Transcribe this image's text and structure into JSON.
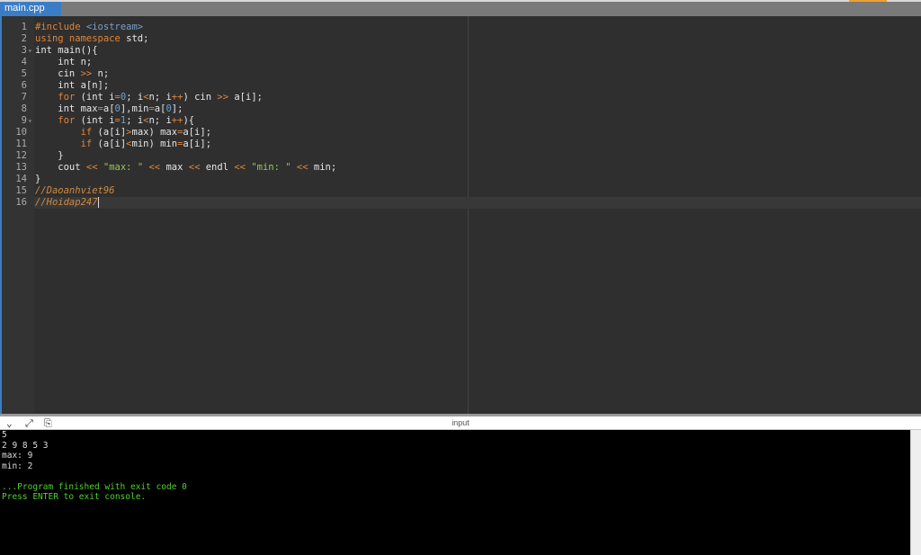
{
  "tab": {
    "label": "main.cpp"
  },
  "code": [
    [
      [
        "#include ",
        "kw"
      ],
      [
        "<iostream>",
        "inc"
      ]
    ],
    [
      [
        "using namespace",
        "kw"
      ],
      [
        " std;",
        ""
      ]
    ],
    [
      [
        "int main(){",
        ""
      ]
    ],
    [
      [
        "    int n;",
        ""
      ]
    ],
    [
      [
        "    cin ",
        ""
      ],
      [
        ">>",
        "op"
      ],
      [
        " n;",
        ""
      ]
    ],
    [
      [
        "    int a[n];",
        ""
      ]
    ],
    [
      [
        "    ",
        ""
      ],
      [
        "for",
        "kw"
      ],
      [
        " (int i",
        ""
      ],
      [
        "=",
        "op"
      ],
      [
        "0",
        "num"
      ],
      [
        "; i",
        ""
      ],
      [
        "<",
        "op"
      ],
      [
        "n; i",
        ""
      ],
      [
        "++",
        "op"
      ],
      [
        ") cin ",
        ""
      ],
      [
        ">>",
        "op"
      ],
      [
        " a[i];",
        ""
      ]
    ],
    [
      [
        "    int max",
        ""
      ],
      [
        "=",
        "op"
      ],
      [
        "a[",
        ""
      ],
      [
        "0",
        "num"
      ],
      [
        "],min",
        ""
      ],
      [
        "=",
        "op"
      ],
      [
        "a[",
        ""
      ],
      [
        "0",
        "num"
      ],
      [
        "];",
        ""
      ]
    ],
    [
      [
        "    ",
        ""
      ],
      [
        "for",
        "kw"
      ],
      [
        " (int i",
        ""
      ],
      [
        "=",
        "op"
      ],
      [
        "1",
        "num"
      ],
      [
        "; i",
        ""
      ],
      [
        "<",
        "op"
      ],
      [
        "n; i",
        ""
      ],
      [
        "++",
        "op"
      ],
      [
        "){",
        ""
      ]
    ],
    [
      [
        "        ",
        ""
      ],
      [
        "if",
        "kw"
      ],
      [
        " (a[i]",
        ""
      ],
      [
        ">",
        "op"
      ],
      [
        "max) max",
        ""
      ],
      [
        "=",
        "op"
      ],
      [
        "a[i];",
        ""
      ]
    ],
    [
      [
        "        ",
        ""
      ],
      [
        "if",
        "kw"
      ],
      [
        " (a[i]",
        ""
      ],
      [
        "<",
        "op"
      ],
      [
        "min) min",
        ""
      ],
      [
        "=",
        "op"
      ],
      [
        "a[i];",
        ""
      ]
    ],
    [
      [
        "    }",
        ""
      ]
    ],
    [
      [
        "    cout ",
        ""
      ],
      [
        "<<",
        "op"
      ],
      [
        " ",
        ""
      ],
      [
        "\"max: \"",
        "str"
      ],
      [
        " ",
        ""
      ],
      [
        "<<",
        "op"
      ],
      [
        " max ",
        ""
      ],
      [
        "<<",
        "op"
      ],
      [
        " endl ",
        ""
      ],
      [
        "<<",
        "op"
      ],
      [
        " ",
        ""
      ],
      [
        "\"min: \"",
        "str"
      ],
      [
        " ",
        ""
      ],
      [
        "<<",
        "op"
      ],
      [
        " min;",
        ""
      ]
    ],
    [
      [
        "}",
        ""
      ]
    ],
    [
      [
        "//Daoanhviet96",
        "cm"
      ]
    ],
    [
      [
        "//Hoidap247",
        "cm"
      ]
    ]
  ],
  "console": {
    "title": "input",
    "lines": [
      "5",
      "2 9 8 5 3",
      "max: 9",
      "min: 2",
      ""
    ],
    "status_lines": [
      "...Program finished with exit code 0",
      "Press ENTER to exit console."
    ]
  }
}
